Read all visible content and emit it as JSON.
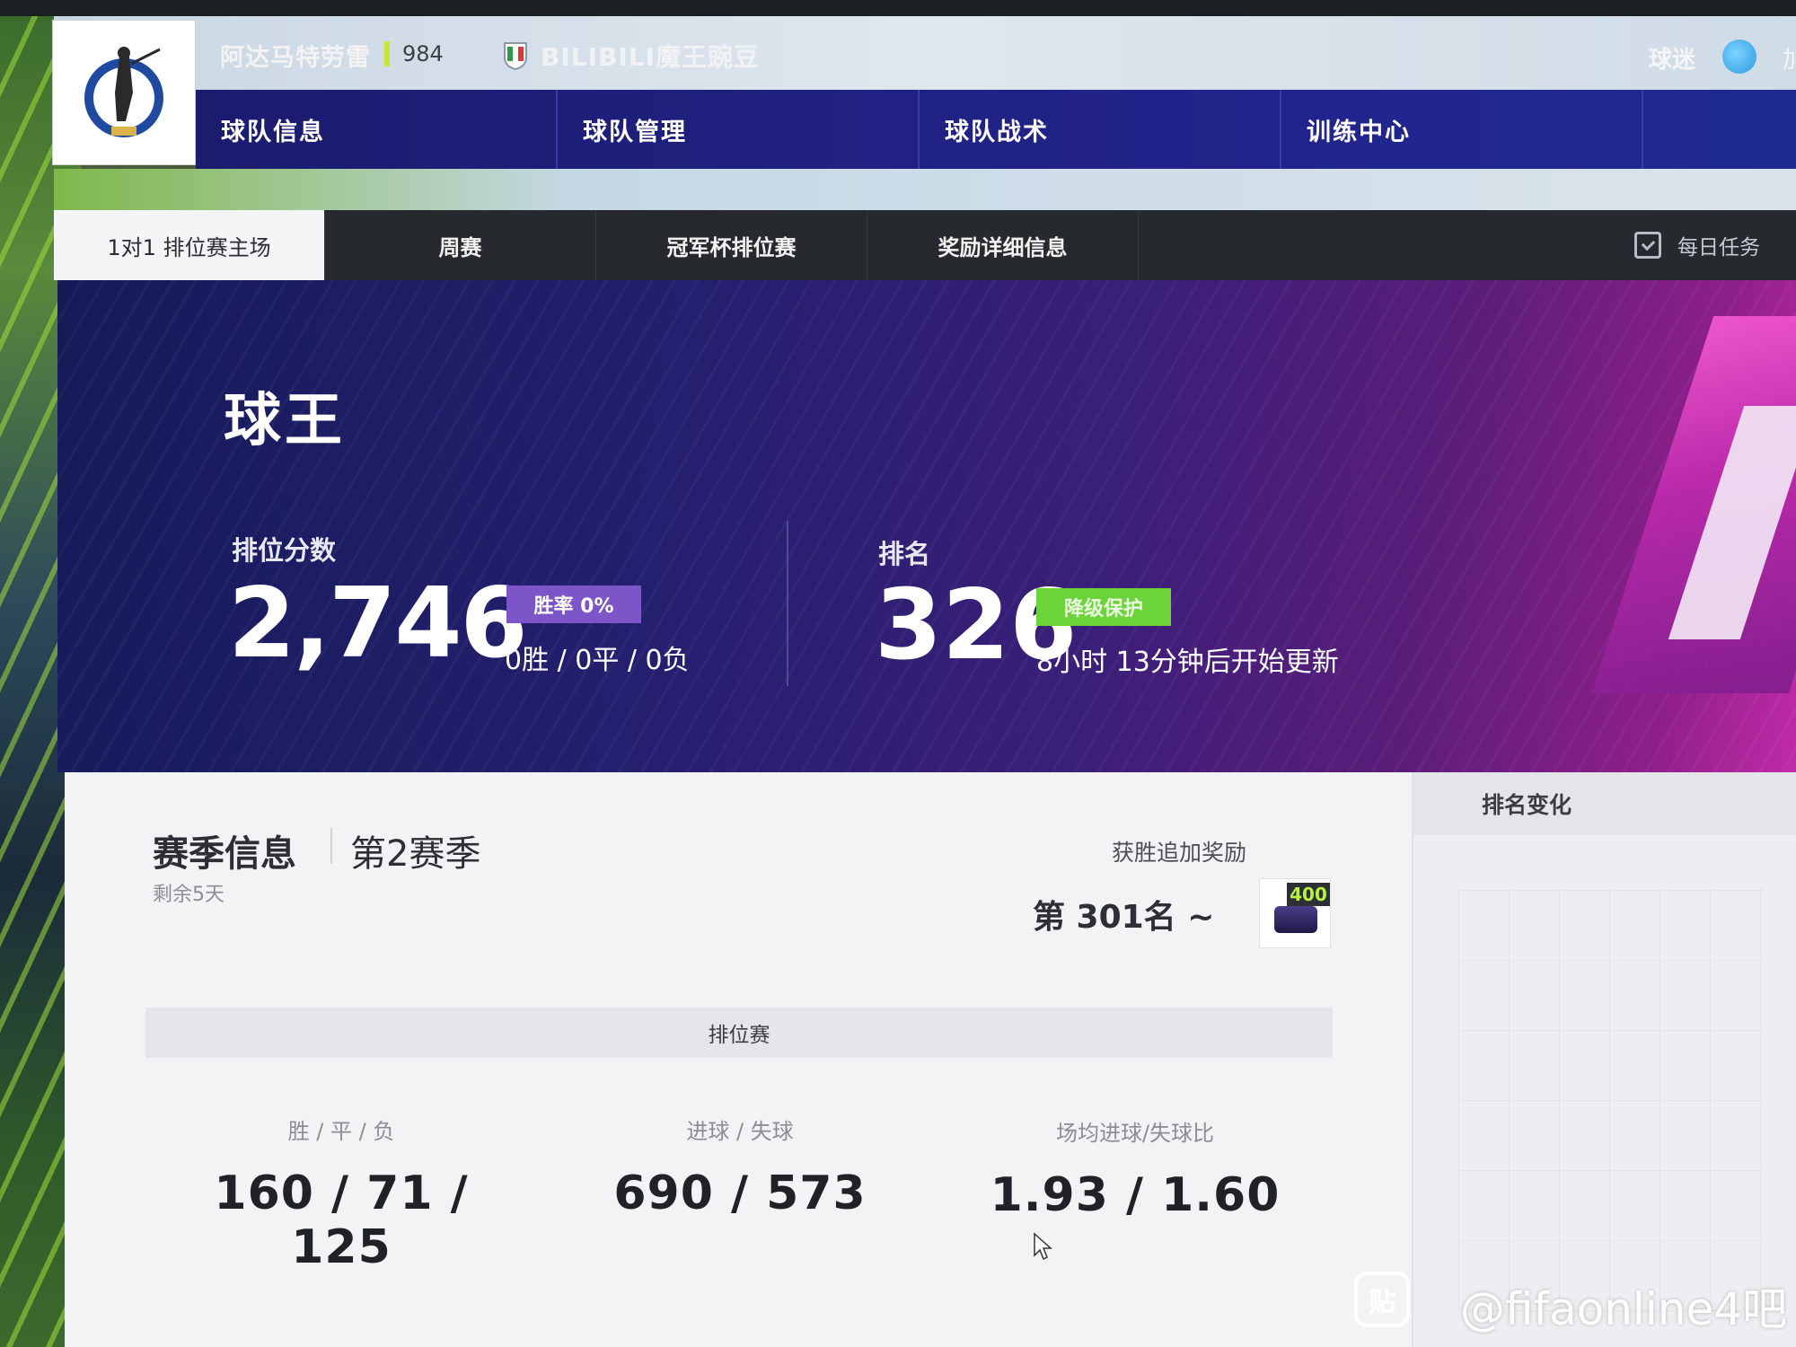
{
  "header": {
    "player_name": "阿达马特劳雷",
    "level": "984",
    "team_name": "BILIBILI魔王豌豆",
    "fans_label": "球迷",
    "fans_extra": "加"
  },
  "main_nav": [
    "球队信息",
    "球队管理",
    "球队战术",
    "训练中心"
  ],
  "sub_nav": [
    "1对1 排位赛主场",
    "周赛",
    "冠军杯排位赛",
    "奖励详细信息"
  ],
  "daily_task_label": "每日任务",
  "hero": {
    "tier": "球王",
    "score_label": "排位分数",
    "score_value": "2,746",
    "winrate_badge": "胜率 0%",
    "record": "0胜 / 0平 / 0负",
    "rank_label": "排名",
    "rank_value": "326",
    "protect_badge": "降级保护",
    "update_text": "8小时 13分钟后开始更新"
  },
  "season": {
    "title": "赛季信息",
    "name": "第2赛季",
    "remaining": "剩余5天",
    "bonus_label": "获胜追加奖励",
    "bonus_rank": "第 301名 ~",
    "bonus_amount": "400",
    "ranked_header": "排位赛",
    "stats": [
      {
        "label": "胜 / 平 / 负",
        "value": "160 / 71 / 125"
      },
      {
        "label": "进球 / 失球",
        "value": "690 / 573"
      },
      {
        "label": "场均进球/失球比",
        "value": "1.93 / 1.60"
      }
    ]
  },
  "rank_change_title": "排名变化",
  "watermark": {
    "icon_glyph": "贴",
    "text": "@fifaonline4吧"
  },
  "colors": {
    "nav_bg": "#1b1c6e",
    "winrate_badge": "#7c55c8",
    "protect_badge": "#6cd43a",
    "level_accent": "#c6e63a"
  }
}
